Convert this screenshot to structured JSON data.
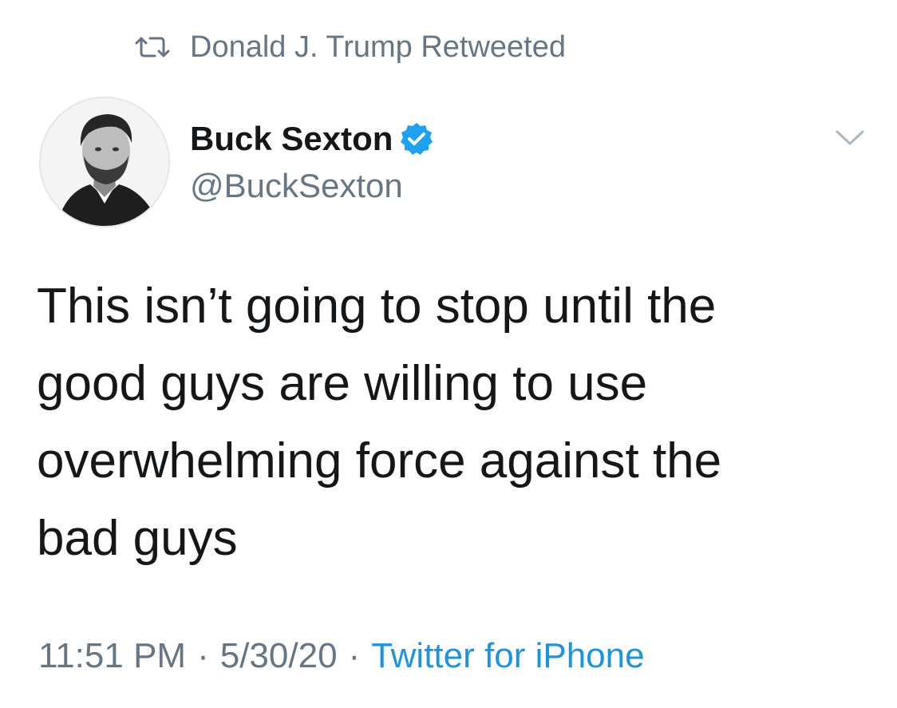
{
  "retweet_banner": {
    "icon": "retweet-icon",
    "text": "Donald J. Trump Retweeted"
  },
  "author": {
    "display_name": "Buck Sexton",
    "handle": "@BuckSexton",
    "verified": true,
    "verified_icon": "verified-badge-icon",
    "avatar_icon": "avatar"
  },
  "menu": {
    "icon": "chevron-down-icon"
  },
  "tweet": {
    "text": "This isn’t going to stop until the\ngood guys are willing to use\noverwhelming force against the\nbad guys"
  },
  "meta": {
    "time": "11:51 PM",
    "separator": "·",
    "date": "5/30/20",
    "source": "Twitter for iPhone"
  },
  "colors": {
    "text_primary": "#14171a",
    "text_secondary": "#657786",
    "link": "#1b95e0",
    "verified_blue": "#1da1f2",
    "background": "#ffffff"
  }
}
